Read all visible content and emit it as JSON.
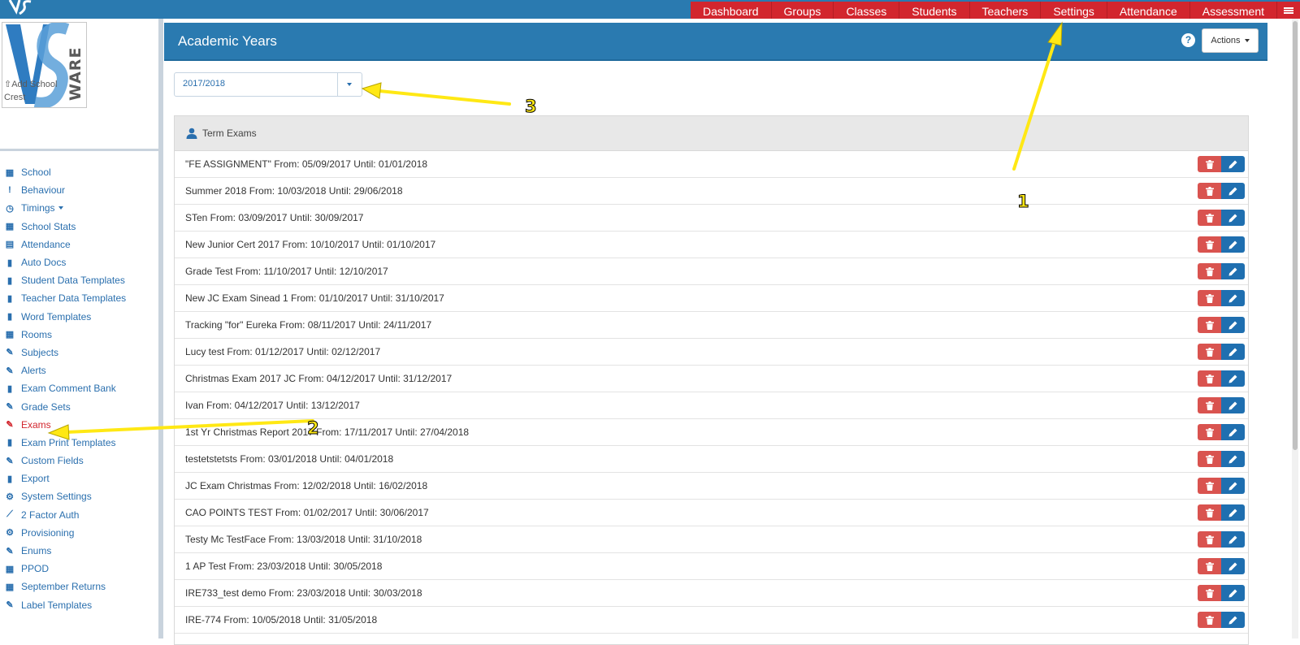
{
  "nav": {
    "items": [
      "Dashboard",
      "Groups",
      "Classes",
      "Students",
      "Teachers",
      "Settings",
      "Attendance",
      "Assessment"
    ],
    "menu_icon": "hamburger-icon"
  },
  "crest": {
    "caption": "Add School Crest",
    "logo_text": "VS WARE"
  },
  "sidebar": {
    "items": [
      {
        "label": "School",
        "icon": "building-icon"
      },
      {
        "label": "Behaviour",
        "icon": "exclamation-icon"
      },
      {
        "label": "Timings",
        "icon": "clock-icon"
      },
      {
        "label": "School Stats",
        "icon": "building-icon"
      },
      {
        "label": "Attendance",
        "icon": "calendar-icon"
      },
      {
        "label": "Auto Docs",
        "icon": "file-icon"
      },
      {
        "label": "Student Data Templates",
        "icon": "file-icon"
      },
      {
        "label": "Teacher Data Templates",
        "icon": "file-icon"
      },
      {
        "label": "Word Templates",
        "icon": "file-icon"
      },
      {
        "label": "Rooms",
        "icon": "building-icon"
      },
      {
        "label": "Subjects",
        "icon": "edit-icon"
      },
      {
        "label": "Alerts",
        "icon": "edit-icon"
      },
      {
        "label": "Exam Comment Bank",
        "icon": "file-icon"
      },
      {
        "label": "Grade Sets",
        "icon": "edit-icon"
      },
      {
        "label": "Exams",
        "icon": "edit-icon"
      },
      {
        "label": "Exam Print Templates",
        "icon": "file-icon"
      },
      {
        "label": "Custom Fields",
        "icon": "edit-icon"
      },
      {
        "label": "Export",
        "icon": "file-icon"
      },
      {
        "label": "System Settings",
        "icon": "cogs-icon"
      },
      {
        "label": "2 Factor Auth",
        "icon": "chart-icon"
      },
      {
        "label": "Provisioning",
        "icon": "cogs-icon"
      },
      {
        "label": "Enums",
        "icon": "edit-icon"
      },
      {
        "label": "PPOD",
        "icon": "building-icon"
      },
      {
        "label": "September Returns",
        "icon": "building-icon"
      },
      {
        "label": "Label Templates",
        "icon": "edit-icon"
      }
    ],
    "active": "Exams"
  },
  "header": {
    "title": "Academic Years",
    "help": "?",
    "actions_label": "Actions"
  },
  "year_select": {
    "value": "2017/2018"
  },
  "panel": {
    "title": "Term Exams",
    "rows": [
      "\"FE ASSIGNMENT\" From: 05/09/2017 Until: 01/01/2018",
      "Summer 2018 From: 10/03/2018 Until: 29/06/2018",
      "STen From: 03/09/2017 Until: 30/09/2017",
      "New Junior Cert 2017 From: 10/10/2017 Until: 01/10/2017",
      "Grade Test From: 11/10/2017 Until: 12/10/2017",
      "New JC Exam Sinead 1 From: 01/10/2017 Until: 31/10/2017",
      "Tracking \"for\" Eureka From: 08/11/2017 Until: 24/11/2017",
      "Lucy test From: 01/12/2017 Until: 02/12/2017",
      "Christmas Exam 2017 JC From: 04/12/2017 Until: 31/12/2017",
      "Ivan From: 04/12/2017 Until: 13/12/2017",
      "1st Yr Christmas Report 2017 From: 17/11/2017 Until: 27/04/2018",
      "testetstetsts From: 03/01/2018 Until: 04/01/2018",
      "JC Exam Christmas From: 12/02/2018 Until: 16/02/2018",
      "CAO POINTS TEST From: 01/02/2017 Until: 30/06/2017",
      "Testy Mc TestFace From: 13/03/2018 Until: 31/10/2018",
      "1 AP Test From: 23/03/2018 Until: 30/05/2018",
      "IRE733_test demo From: 23/03/2018 Until: 30/03/2018",
      "IRE-774 From: 10/05/2018 Until: 31/05/2018"
    ]
  },
  "annotations": [
    "1",
    "2",
    "3"
  ],
  "colors": {
    "brand_blue": "#2a7ab0",
    "nav_red": "#d2262e",
    "link_blue": "#2a6fae",
    "delete_red": "#d9534f",
    "edit_blue": "#1f6fb0",
    "arrow_yellow": "#ffe814"
  }
}
